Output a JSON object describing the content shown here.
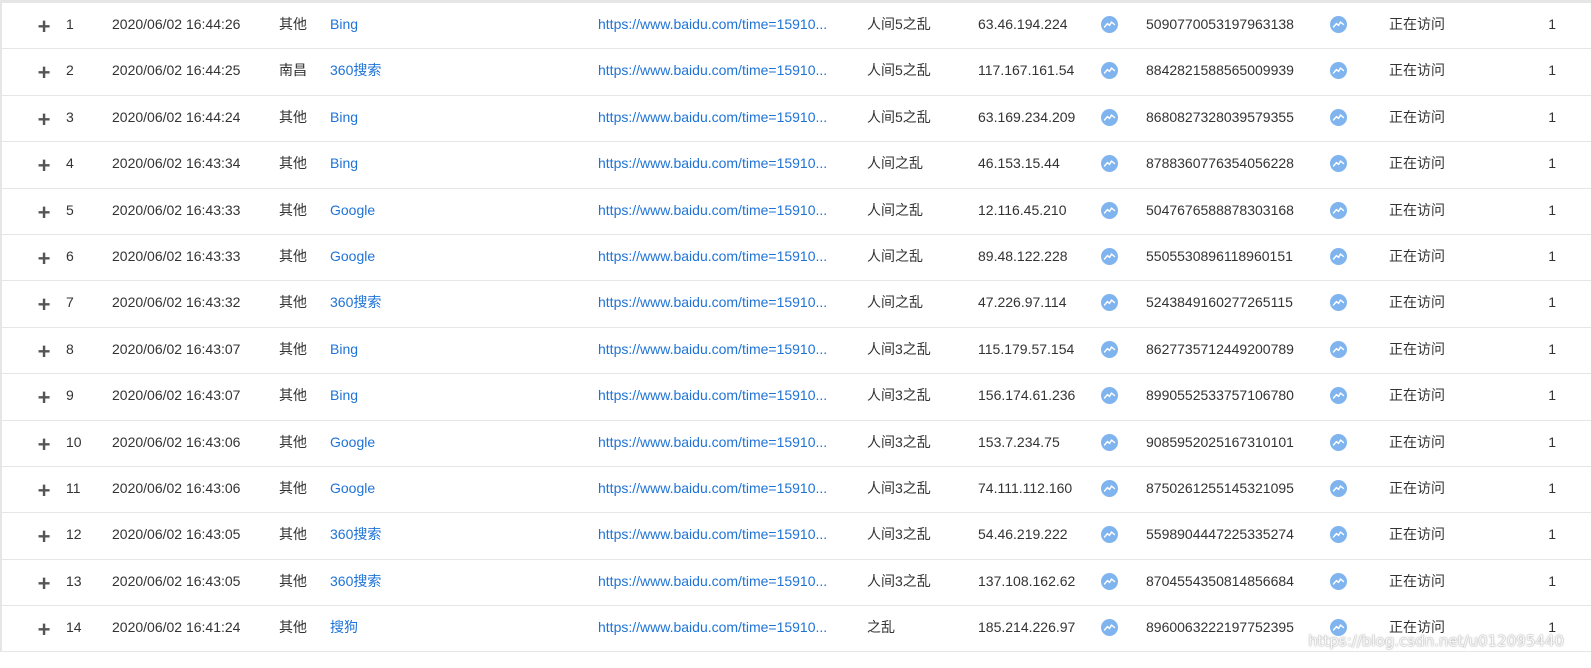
{
  "colors": {
    "link": "#1e73d6",
    "trend_icon": "#7fb4ee",
    "border": "#e6e6e6",
    "text": "#333333"
  },
  "icons": {
    "expand": "plus-icon",
    "trend": "trend-chart-icon"
  },
  "glyphs": {
    "plus": "+"
  },
  "rows": [
    {
      "num": "1",
      "time": "2020/06/02 16:44:26",
      "city": "其他",
      "engine": "Bing",
      "url": "https://www.baidu.com/time=15910...",
      "page": "人间5之乱",
      "ip": "63.46.194.224",
      "uid": "5090770053197963138",
      "status": "正在访问",
      "count": "1"
    },
    {
      "num": "2",
      "time": "2020/06/02 16:44:25",
      "city": "南昌",
      "engine": "360搜索",
      "url": "https://www.baidu.com/time=15910...",
      "page": "人间5之乱",
      "ip": "117.167.161.54",
      "uid": "8842821588565009939",
      "status": "正在访问",
      "count": "1"
    },
    {
      "num": "3",
      "time": "2020/06/02 16:44:24",
      "city": "其他",
      "engine": "Bing",
      "url": "https://www.baidu.com/time=15910...",
      "page": "人间5之乱",
      "ip": "63.169.234.209",
      "uid": "8680827328039579355",
      "status": "正在访问",
      "count": "1"
    },
    {
      "num": "4",
      "time": "2020/06/02 16:43:34",
      "city": "其他",
      "engine": "Bing",
      "url": "https://www.baidu.com/time=15910...",
      "page": "人间之乱",
      "ip": "46.153.15.44",
      "uid": "8788360776354056228",
      "status": "正在访问",
      "count": "1"
    },
    {
      "num": "5",
      "time": "2020/06/02 16:43:33",
      "city": "其他",
      "engine": "Google",
      "url": "https://www.baidu.com/time=15910...",
      "page": "人间之乱",
      "ip": "12.116.45.210",
      "uid": "5047676588878303168",
      "status": "正在访问",
      "count": "1"
    },
    {
      "num": "6",
      "time": "2020/06/02 16:43:33",
      "city": "其他",
      "engine": "Google",
      "url": "https://www.baidu.com/time=15910...",
      "page": "人间之乱",
      "ip": "89.48.122.228",
      "uid": "5505530896118960151",
      "status": "正在访问",
      "count": "1"
    },
    {
      "num": "7",
      "time": "2020/06/02 16:43:32",
      "city": "其他",
      "engine": "360搜索",
      "url": "https://www.baidu.com/time=15910...",
      "page": "人间之乱",
      "ip": "47.226.97.114",
      "uid": "5243849160277265115",
      "status": "正在访问",
      "count": "1"
    },
    {
      "num": "8",
      "time": "2020/06/02 16:43:07",
      "city": "其他",
      "engine": "Bing",
      "url": "https://www.baidu.com/time=15910...",
      "page": "人间3之乱",
      "ip": "115.179.57.154",
      "uid": "8627735712449200789",
      "status": "正在访问",
      "count": "1"
    },
    {
      "num": "9",
      "time": "2020/06/02 16:43:07",
      "city": "其他",
      "engine": "Bing",
      "url": "https://www.baidu.com/time=15910...",
      "page": "人间3之乱",
      "ip": "156.174.61.236",
      "uid": "8990552533757106780",
      "status": "正在访问",
      "count": "1"
    },
    {
      "num": "10",
      "time": "2020/06/02 16:43:06",
      "city": "其他",
      "engine": "Google",
      "url": "https://www.baidu.com/time=15910...",
      "page": "人间3之乱",
      "ip": "153.7.234.75",
      "uid": "9085952025167310101",
      "status": "正在访问",
      "count": "1"
    },
    {
      "num": "11",
      "time": "2020/06/02 16:43:06",
      "city": "其他",
      "engine": "Google",
      "url": "https://www.baidu.com/time=15910...",
      "page": "人间3之乱",
      "ip": "74.111.112.160",
      "uid": "8750261255145321095",
      "status": "正在访问",
      "count": "1"
    },
    {
      "num": "12",
      "time": "2020/06/02 16:43:05",
      "city": "其他",
      "engine": "360搜索",
      "url": "https://www.baidu.com/time=15910...",
      "page": "人间3之乱",
      "ip": "54.46.219.222",
      "uid": "5598904447225335274",
      "status": "正在访问",
      "count": "1"
    },
    {
      "num": "13",
      "time": "2020/06/02 16:43:05",
      "city": "其他",
      "engine": "360搜索",
      "url": "https://www.baidu.com/time=15910...",
      "page": "人间3之乱",
      "ip": "137.108.162.62",
      "uid": "8704554350814856684",
      "status": "正在访问",
      "count": "1"
    },
    {
      "num": "14",
      "time": "2020/06/02 16:41:24",
      "city": "其他",
      "engine": "搜狗",
      "url": "https://www.baidu.com/time=15910...",
      "page": "之乱",
      "ip": "185.214.226.97",
      "uid": "8960063222197752395",
      "status": "正在访问",
      "count": "1"
    }
  ],
  "watermark": "https://blog.csdn.net/u012095440"
}
